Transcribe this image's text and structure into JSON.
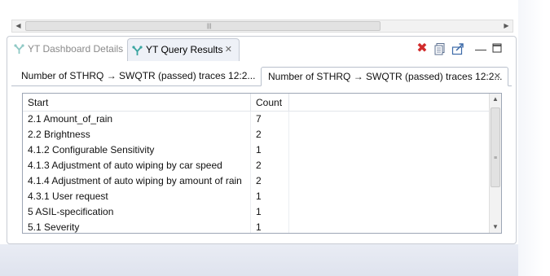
{
  "view_tabs": {
    "inactive_label": "YT Dashboard Details",
    "active_label": "YT Query Results"
  },
  "toolbar": {
    "remove_icon": "red-x-icon",
    "copy_icon": "copy-icon",
    "export_icon": "export-icon",
    "minimize_glyph": "—",
    "maximize_icon": "maximize-icon"
  },
  "inner_tabs": [
    {
      "label": "Number of STHRQ → SWQTR (passed) traces 12:2..."
    },
    {
      "label": "Number of STHRQ → SWQTR (passed) traces 12:2..."
    }
  ],
  "table": {
    "columns": [
      "Start",
      "Count",
      ""
    ],
    "rows": [
      {
        "start": "2.1 Amount_of_rain",
        "count": "7"
      },
      {
        "start": "2.2 Brightness",
        "count": "2"
      },
      {
        "start": "4.1.2 Configurable Sensitivity",
        "count": "1"
      },
      {
        "start": "4.1.3 Adjustment of auto wiping by car speed",
        "count": "2"
      },
      {
        "start": "4.1.4 Adjustment of auto wiping by amount of rain",
        "count": "2"
      },
      {
        "start": "4.3.1 User request",
        "count": "1"
      },
      {
        "start": "5 ASIL-specification",
        "count": "1"
      },
      {
        "start": "5.1 Severity",
        "count": "1"
      }
    ]
  },
  "colors": {
    "panel_border": "#c8ccd4",
    "active_tab_bg": "#eef1f7",
    "close_red": "#d12b2b",
    "icon_teal": "#3aa5a0"
  }
}
